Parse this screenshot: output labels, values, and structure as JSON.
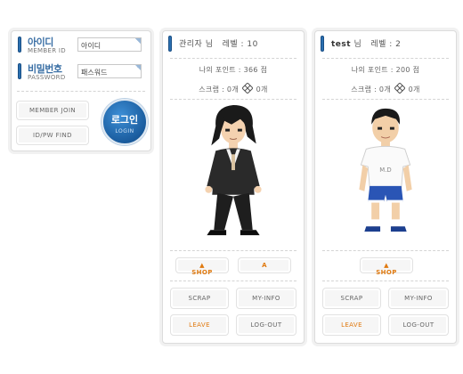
{
  "login": {
    "id_label": "아이디",
    "id_sub": "MEMBER ID",
    "id_value": "아이디",
    "pw_label": "비밀번호",
    "pw_sub": "PASSWORD",
    "pw_value": "패스워드",
    "member_join": "MEMBER JOIN",
    "find": "ID/PW FIND",
    "login_ko": "로그인",
    "login_en": "LOGIN"
  },
  "cards": [
    {
      "name": "관리자",
      "honorific": "님",
      "level_label": "레벨 : 10",
      "points": "나의 포인트 : 366 점",
      "scrap_label": "스크랩 : 0개",
      "scrap_count": "0개",
      "shop_label": "SHOP",
      "extra_label": "A",
      "scrap_btn": "SCRAP",
      "myinfo_btn": "MY-INFO",
      "leave_btn": "LEAVE",
      "logout_btn": "LOG-OUT"
    },
    {
      "name": "test",
      "honorific": "님",
      "level_label": "레벨 : 2",
      "points": "나의 포인트 : 200 점",
      "scrap_label": "스크랩 : 0개",
      "scrap_count": "0개",
      "shop_label": "SHOP",
      "shirt_text": "M.D",
      "scrap_btn": "SCRAP",
      "myinfo_btn": "MY-INFO",
      "leave_btn": "LEAVE",
      "logout_btn": "LOG-OUT"
    }
  ],
  "colors": {
    "accent": "#2a6fb0",
    "shop": "#e07a10",
    "border": "#dcdcdc"
  },
  "icons": [
    "scrap-diamond-icon",
    "shop-arrow-icon",
    "field-corner-icon"
  ]
}
